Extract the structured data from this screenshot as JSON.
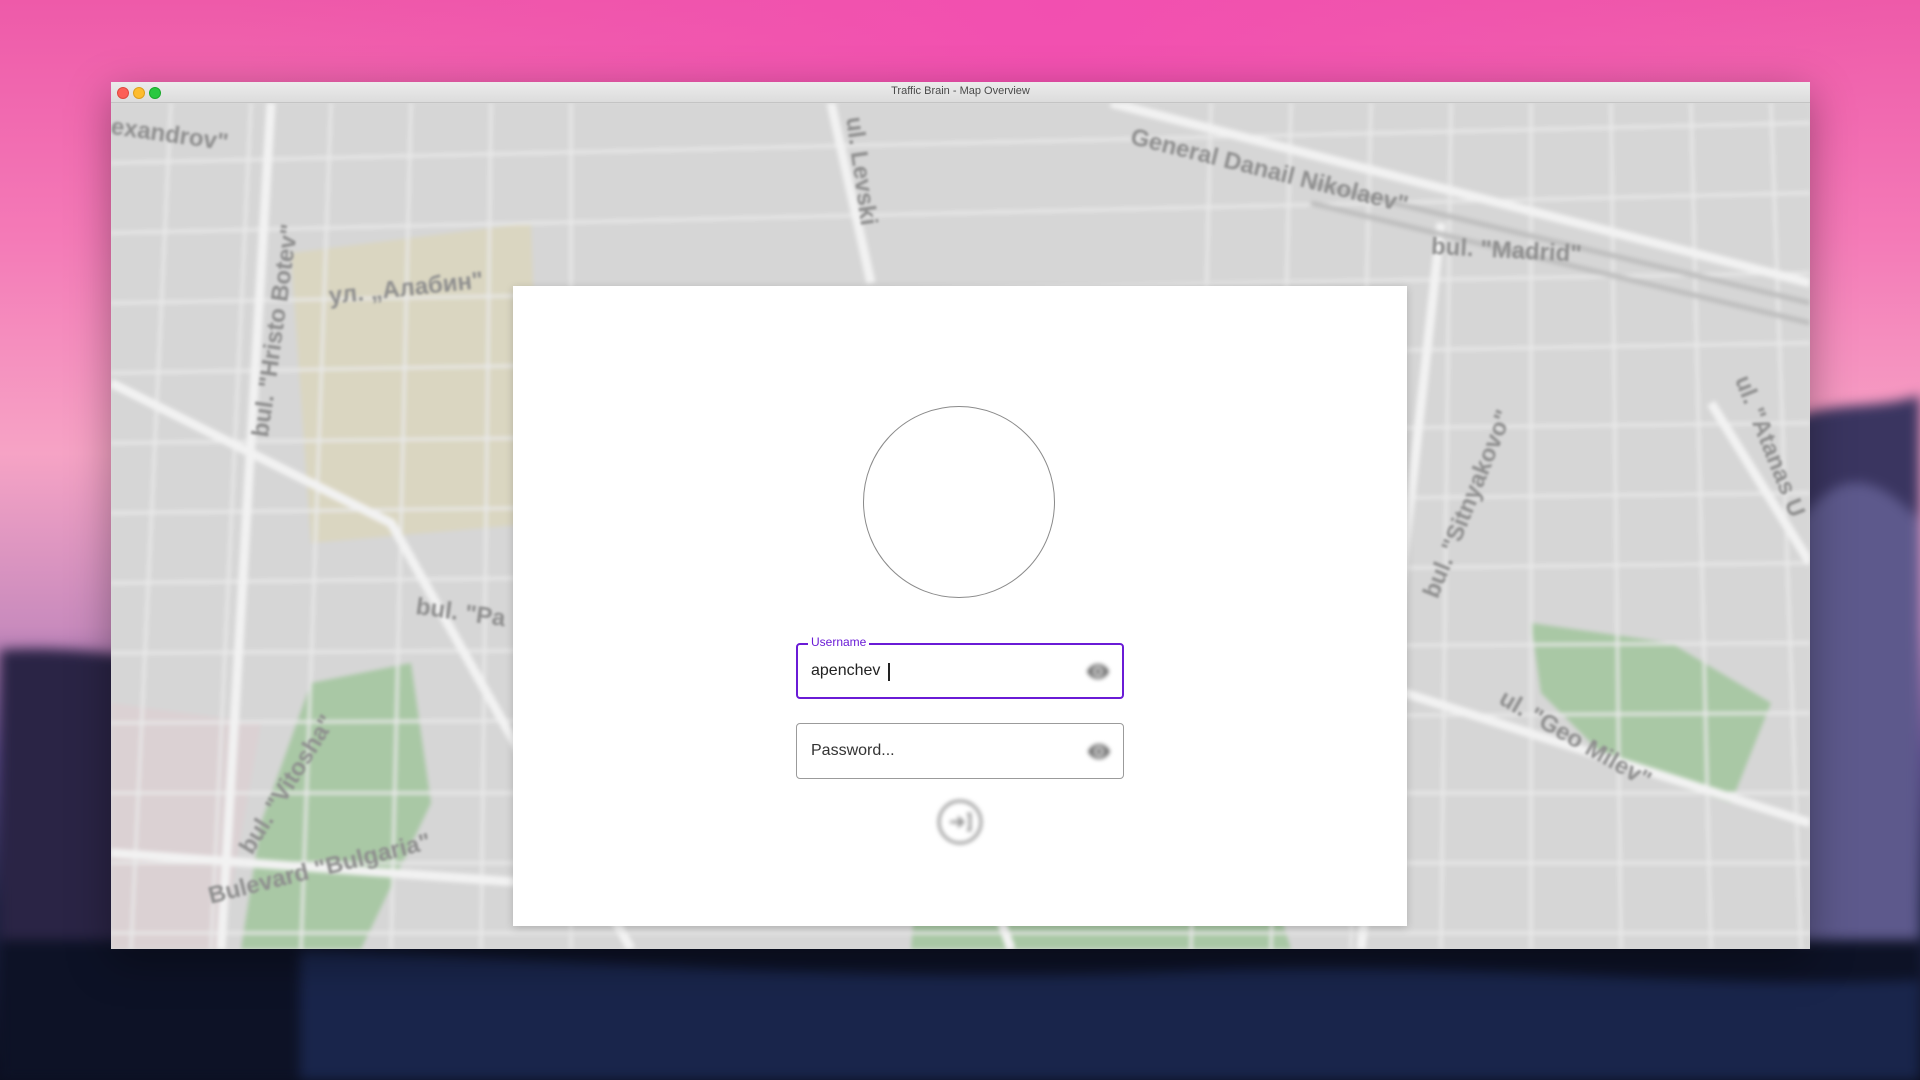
{
  "window": {
    "title": "Traffic Brain - Map Overview"
  },
  "map": {
    "labels": [
      "exandrov\"",
      "bul. \"Hristo Botev\"",
      "ул. „Алабин\"",
      "bul. \"Pa",
      "bul. \"Vitosha\"",
      "Bulevard \"Bulgaria\"",
      "ul. Levski",
      "General Danail Nikolaev\"",
      "bul. \"Madrid\"",
      "bul. \"Sitnyakovo\"",
      "ul. \"Atanas U",
      "ul. \"Geo Milev\""
    ]
  },
  "login": {
    "username": {
      "label": "Username",
      "value": "apenchev "
    },
    "password": {
      "placeholder": "Password...",
      "value": ""
    },
    "icons": {
      "avatar": "avatar-placeholder",
      "visibility": "eye-icon",
      "submit": "login-icon"
    }
  },
  "colors": {
    "accent": "#6a1bd6",
    "close": "#fc5f57",
    "minimize": "#fdbc2e",
    "maximize": "#29c840"
  }
}
